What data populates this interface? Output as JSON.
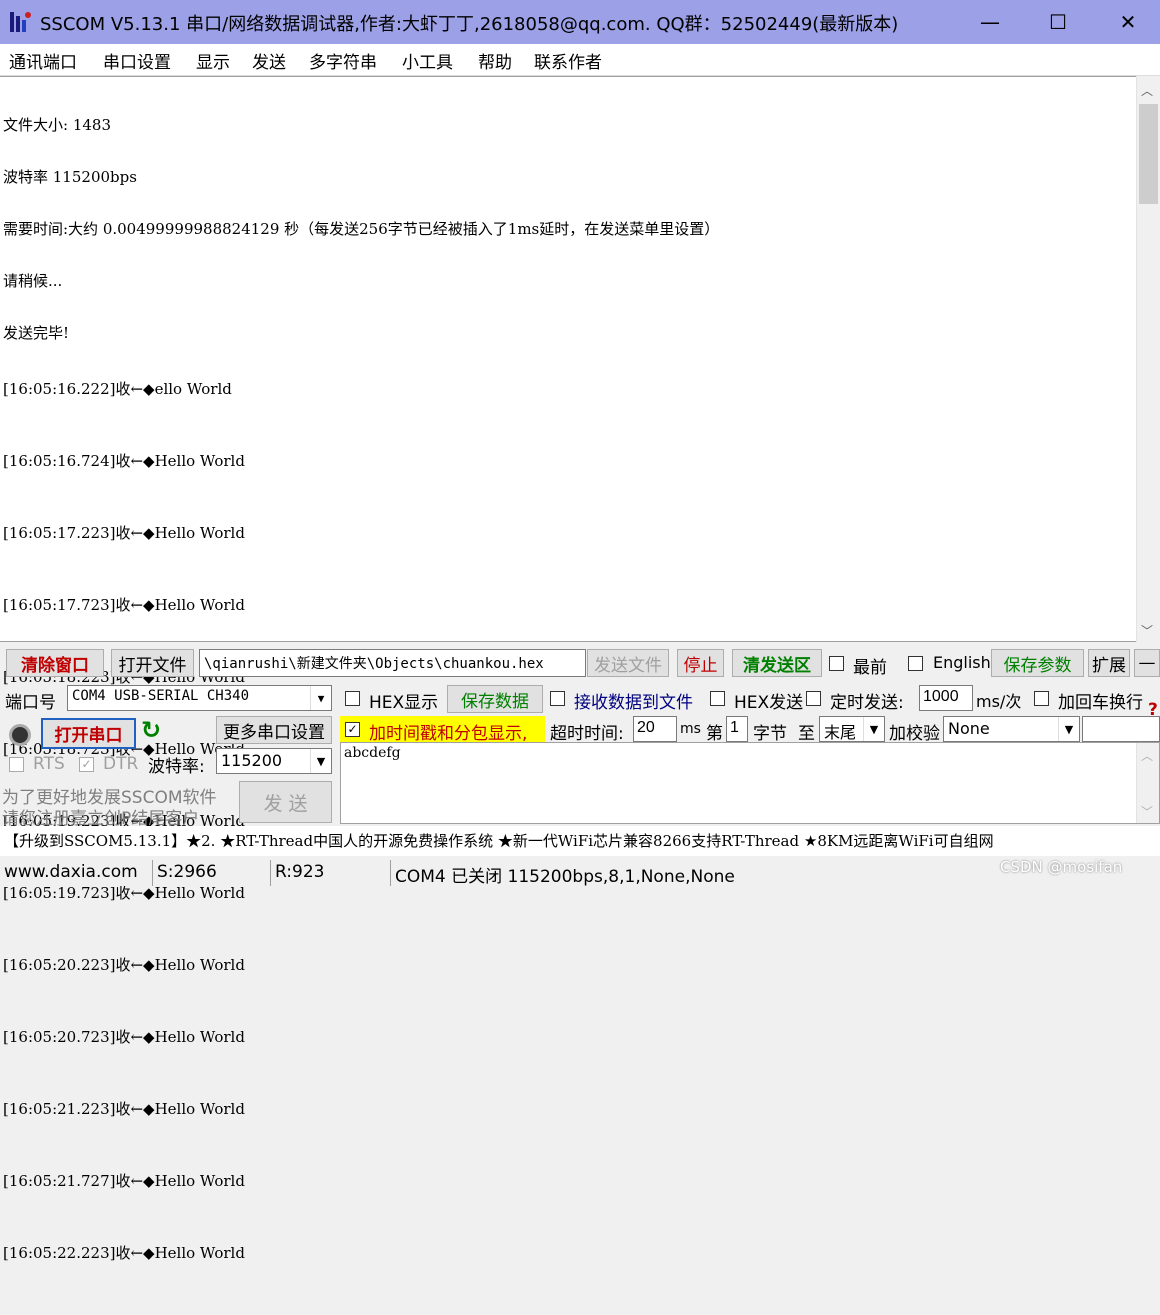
{
  "window": {
    "title": "SSCOM V5.13.1 串口/网络数据调试器,作者:大虾丁丁,2618058@qq.com. QQ群：52502449(最新版本)",
    "minimize": "—",
    "maximize": "☐",
    "close": "✕"
  },
  "menu": [
    "通讯端口",
    "串口设置",
    "显示",
    "发送",
    "多字符串",
    "小工具",
    "帮助",
    "联系作者"
  ],
  "receive": {
    "header_lines": [
      "文件大小: 1483",
      "波特率 115200bps",
      "需要时间:大约 0.00499999988824129 秒（每发送256字节已经被插入了1ms延时，在发送菜单里设置）",
      "请稍候...",
      "发送完毕!"
    ],
    "lines": [
      "[16:05:16.222]收←◆ello World",
      "[16:05:16.724]收←◆Hello World",
      "[16:05:17.223]收←◆Hello World",
      "[16:05:17.723]收←◆Hello World",
      "[16:05:18.223]收←◆Hello World",
      "[16:05:18.723]收←◆Hello World",
      "[16:05:19.223]收←◆Hello World",
      "[16:05:19.723]收←◆Hello World",
      "[16:05:20.223]收←◆Hello World",
      "[16:05:20.723]收←◆Hello World",
      "[16:05:21.223]收←◆Hello World",
      "[16:05:21.727]收←◆Hello World",
      "[16:05:22.223]收←◆Hello World"
    ]
  },
  "toolbar": {
    "clear_window": "清除窗口",
    "open_file": "打开文件",
    "file_path": "\\qianrushi\\新建文件夹\\Objects\\chuankou.hex",
    "send_file": "发送文件",
    "stop": "停止",
    "clear_send": "清发送区",
    "topmost": "最前",
    "english": "English",
    "save_params": "保存参数",
    "expand": "扩展",
    "collapse": "—"
  },
  "controls": {
    "port_label": "端口号",
    "port_value": "COM4 USB-SERIAL CH340",
    "hex_display": "HEX显示",
    "save_data": "保存数据",
    "recv_to_file": "接收数据到文件",
    "hex_send": "HEX发送",
    "timed_send": "定时发送:",
    "interval": "1000",
    "interval_unit": "ms/次",
    "add_crlf": "加回车换行",
    "open_port": "打开串口",
    "more_settings": "更多串口设置",
    "timestamp": "加时间戳和分包显示,",
    "timeout_label": "超时时间:",
    "timeout_value": "20",
    "timeout_unit": "ms",
    "byte_label": "第",
    "byte_value": "1",
    "byte_unit": "字节",
    "to_label": "至",
    "to_value": "末尾",
    "checksum_label": "加校验",
    "checksum_value": "None",
    "rts": "RTS",
    "dtr": "DTR",
    "baud_label": "波特率:",
    "baud_value": "115200",
    "promo_line1": "为了更好地发展SSCOM软件",
    "promo_line2": "请您注册嘉立创P结尾客户",
    "send_button": "发 送",
    "send_text": "abcdefg"
  },
  "ticker": "【升级到SSCOM5.13.1】★2. ★RT-Thread中国人的开源免费操作系统 ★新一代WiFi芯片兼容8266支持RT-Thread ★8KM远距离WiFi可自组网",
  "status": {
    "website": "www.daxia.com",
    "sent": "S:2966",
    "received": "R:923",
    "port_state": "COM4 已关闭  115200bps,8,1,None,None"
  },
  "watermark": "CSDN @mosifan",
  "colors": {
    "titlebar": "#9ca0e6",
    "accent_red": "#c00000",
    "accent_green": "#008000",
    "highlight_yellow": "#ffff00",
    "ticker_blue": "#0000ff"
  }
}
